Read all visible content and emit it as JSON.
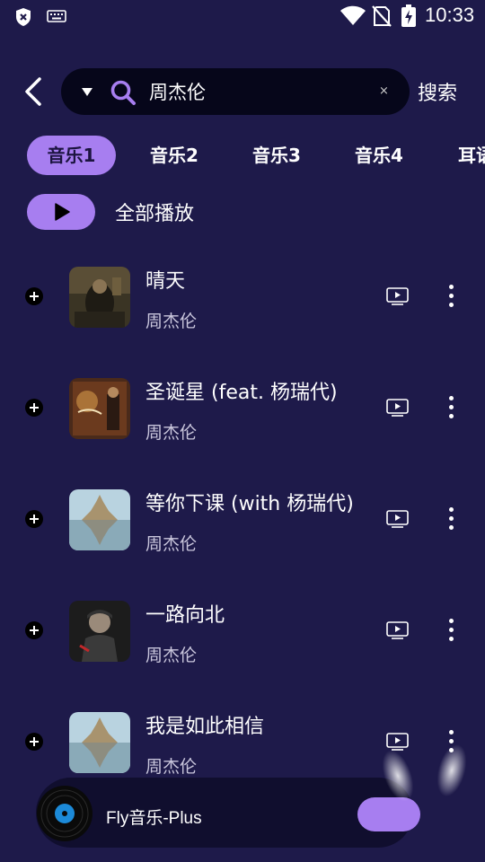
{
  "status_bar": {
    "time": "10:33"
  },
  "search": {
    "query": "周杰伦",
    "clear_glyph": "×",
    "button_label": "搜索"
  },
  "tabs": [
    "音乐1",
    "音乐2",
    "音乐3",
    "音乐4",
    "耳语"
  ],
  "active_tab_index": 0,
  "play_all_label": "全部播放",
  "songs": [
    {
      "title": "晴天",
      "artist": "周杰伦"
    },
    {
      "title": "圣诞星 (feat. 杨瑞代)",
      "artist": "周杰伦"
    },
    {
      "title": "等你下课 (with 杨瑞代)",
      "artist": "周杰伦"
    },
    {
      "title": "一路向北",
      "artist": "周杰伦"
    },
    {
      "title": "我是如此相信",
      "artist": "周杰伦"
    }
  ],
  "mini_player": {
    "title": "Fly音乐-Plus"
  },
  "colors": {
    "background": "#1e1a4a",
    "accent": "#a77ef0",
    "search_bg": "#06061a"
  },
  "icons": [
    "shield-x-icon",
    "keyboard-icon",
    "wifi-icon",
    "no-sim-icon",
    "battery-charging-icon",
    "back-arrow-icon",
    "dropdown-triangle-icon",
    "search-icon",
    "play-icon",
    "add-icon",
    "mv-play-icon",
    "more-vertical-icon",
    "vinyl-disc-icon"
  ]
}
